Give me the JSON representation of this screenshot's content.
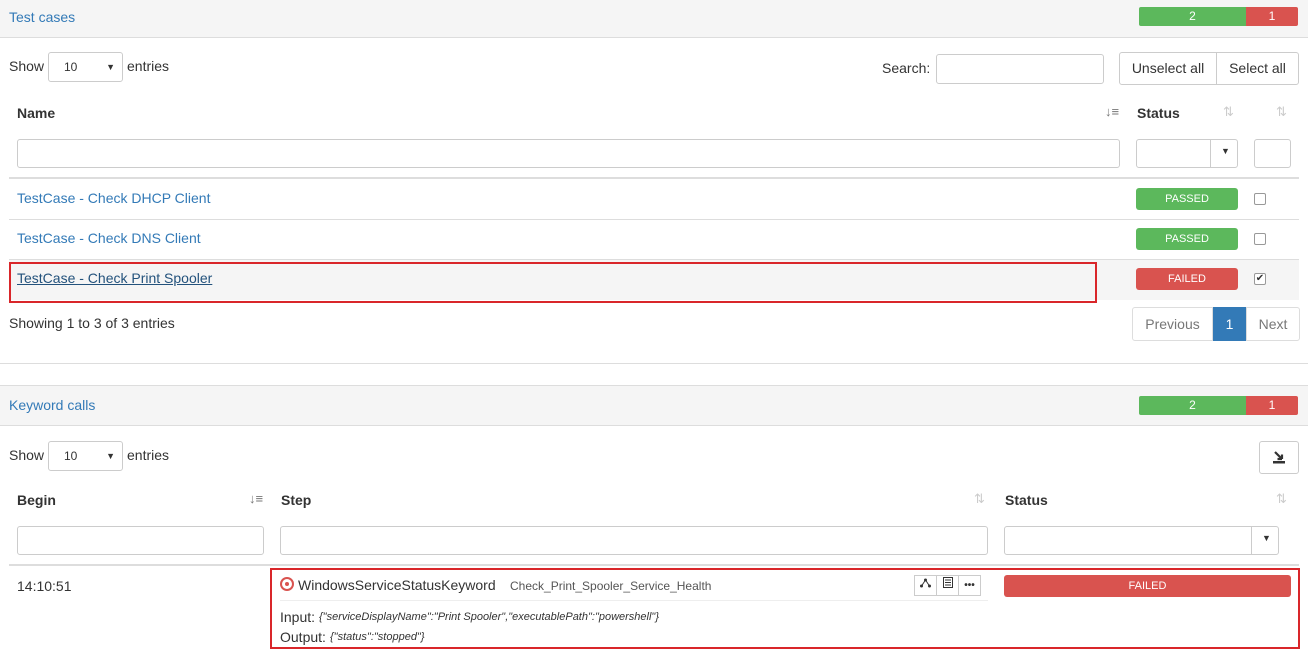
{
  "test_cases": {
    "title": "Test cases",
    "stats": {
      "passed": "2",
      "failed": "1"
    },
    "show_label": "Show",
    "entries_value": "10",
    "entries_label": "entries",
    "search_label": "Search:",
    "unselect_all": "Unselect all",
    "select_all": "Select all",
    "columns": {
      "name": "Name",
      "status": "Status"
    },
    "rows": [
      {
        "name": "TestCase - Check DHCP Client",
        "status": "PASSED",
        "checked": ""
      },
      {
        "name": "TestCase - Check DNS Client",
        "status": "PASSED",
        "checked": ""
      },
      {
        "name": "TestCase - Check Print Spooler",
        "status": "FAILED",
        "checked": "✔"
      }
    ],
    "info": "Showing 1 to 3 of 3 entries",
    "pager": {
      "previous": "Previous",
      "page": "1",
      "next": "Next"
    }
  },
  "keyword_calls": {
    "title": "Keyword calls",
    "stats": {
      "passed": "2",
      "failed": "1"
    },
    "show_label": "Show",
    "entries_value": "10",
    "entries_label": "entries",
    "columns": {
      "begin": "Begin",
      "step": "Step",
      "status": "Status"
    },
    "row": {
      "begin": "14:10:51",
      "keyword": "WindowsServiceStatusKeyword",
      "step_name": "Check_Print_Spooler_Service_Health",
      "input_label": "Input:",
      "input_value": "{\"serviceDisplayName\":\"Print Spooler\",\"executablePath\":\"powershell\"}",
      "output_label": "Output:",
      "output_value": "{\"status\":\"stopped\"}",
      "status": "FAILED"
    }
  },
  "colors": {
    "passed": "#5cb85c",
    "failed": "#d9534f",
    "link": "#337ab7",
    "highlight": "#d9262a"
  }
}
